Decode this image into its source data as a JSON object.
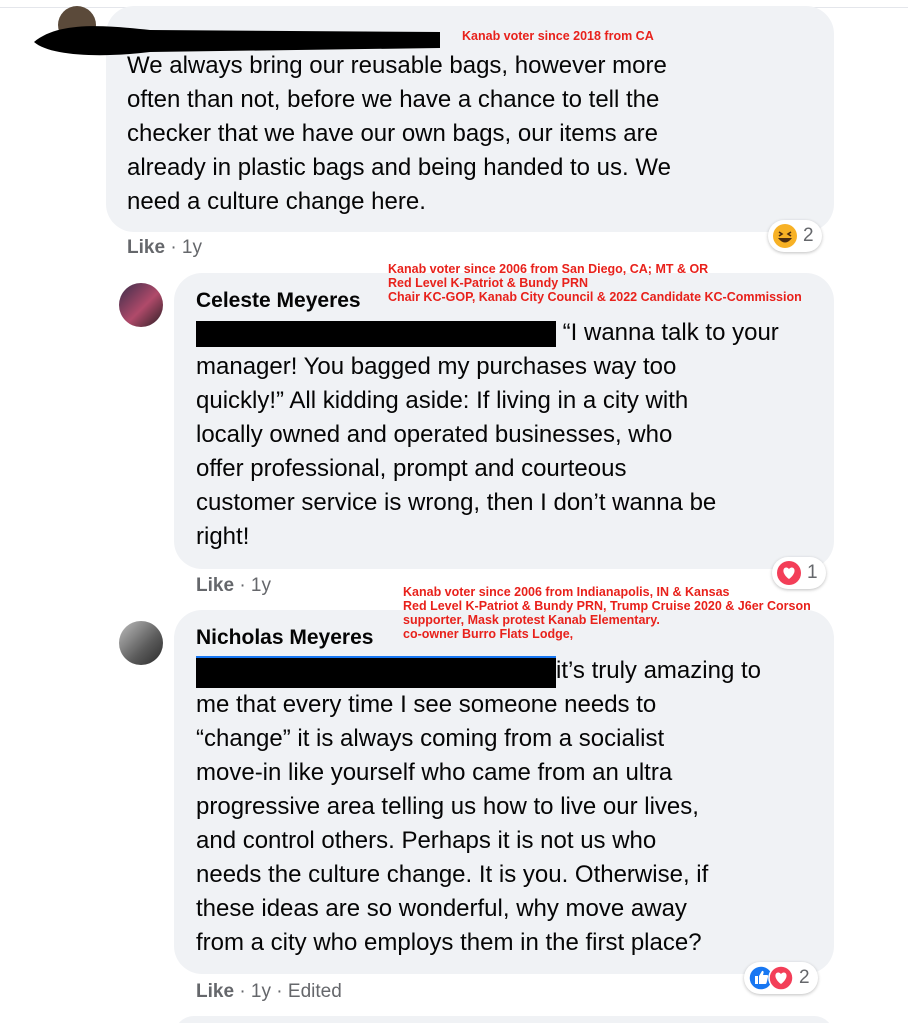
{
  "comments": [
    {
      "text_lines": [
        "We always bring our reusable bags, however more",
        "often than not, before we have a chance to tell the",
        "checker that we have our own bags, our items are",
        "already in plastic bags and being handed to us. We",
        "need a culture change here."
      ],
      "like_label": "Like",
      "age": "1y",
      "reaction_count": "2",
      "annotation": [
        "Kanab voter since 2018 from CA"
      ]
    },
    {
      "author": "Celeste Meyeres",
      "first_line_visible": "“I wanna talk to your",
      "text_lines": [
        "manager! You bagged my purchases way too",
        "quickly!” All kidding aside: If living in a city with",
        "locally owned and operated businesses, who",
        "offer professional, prompt and courteous",
        "customer service is wrong, then I don’t wanna be",
        "right!"
      ],
      "like_label": "Like",
      "age": "1y",
      "reaction_count": "1",
      "annotation": [
        "Kanab voter since 2006 from San Diego, CA; MT & OR",
        "Red Level K-Patriot & Bundy PRN",
        "Chair KC-GOP, Kanab City Council & 2022 Candidate KC-Commission"
      ]
    },
    {
      "author": "Nicholas Meyeres",
      "first_line_visible": "it’s truly amazing to",
      "text_lines": [
        "me that every time I see someone needs to",
        "“change” it is always coming from a socialist",
        "move-in like yourself who came from an ultra",
        "progressive area telling us how to live our lives,",
        "and control others. Perhaps it is not us who",
        "needs the culture change. It is you. Otherwise, if",
        "these ideas are so wonderful, why move away",
        "from a city who employs them in the first place?"
      ],
      "like_label": "Like",
      "age": "1y",
      "edited_label": "Edited",
      "reaction_count": "2",
      "annotation": [
        "Kanab voter since 2006 from Indianapolis, IN & Kansas",
        "Red Level K-Patriot & Bundy PRN, Trump Cruise 2020 & J6er Corson",
        "supporter, Mask protest Kanab Elementary.",
        "co-owner Burro Flats Lodge,"
      ]
    }
  ],
  "icons": {
    "haha": "laughing-emoji-icon",
    "love": "heart-reaction-icon",
    "like": "thumbs-up-reaction-icon"
  },
  "colors": {
    "annotation": "#e8211b",
    "bubble": "#f0f2f5",
    "love": "#f33e58",
    "like": "#1877f2",
    "haha": "#f7b125"
  }
}
